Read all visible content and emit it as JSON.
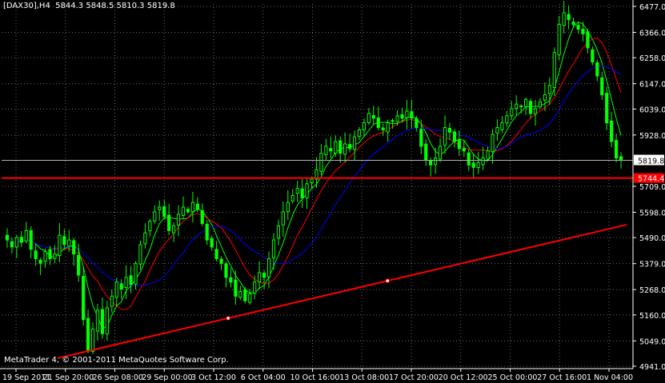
{
  "header": {
    "symbol_label": "[DAX30],H4",
    "open": "5844.3",
    "high": "5848.5",
    "low": "5810.3",
    "close": "5819.8"
  },
  "footer": {
    "copyright": "MetaTrader 4, © 2001-2011 MetaQuotes Software Corp."
  },
  "colors": {
    "background": "#000000",
    "grid": "#c0c0c0",
    "candle": "#00ff00",
    "ma_fast": "#00ff00",
    "ma_mid": "#ff0000",
    "ma_slow": "#0000ff",
    "trendline": "#ff0000",
    "hline": "#ff0000",
    "axis_text": "#ffffff"
  },
  "chart_data": {
    "type": "candlestick",
    "timeframe": "H4",
    "y_ticks": [
      "6477.0",
      "6366.0",
      "6258.0",
      "6147.0",
      "6039.0",
      "5928.0",
      "5819.8",
      "5709.0",
      "5598.0",
      "5490.0",
      "5379.0",
      "5268.0",
      "5160.0",
      "5049.0",
      "4941.0"
    ],
    "ylim": [
      4941.0,
      6477.0
    ],
    "x_ticks": [
      "19 Sep 2011",
      "21 Sep 20:00",
      "26 Sep 08:00",
      "29 Sep 00:00",
      "3 Oct 12:00",
      "6 Oct 04:00",
      "10 Oct 16:00",
      "13 Oct 08:00",
      "17 Oct 20:00",
      "20 Oct 12:00",
      "25 Oct 00:00",
      "27 Oct 16:00",
      "1 Nov 04:00"
    ],
    "current_price_label": "5819.8",
    "horizontal_line": {
      "value": "5744.4",
      "label": "5744.4"
    },
    "trendline": {
      "points": [
        {
          "x": "21 Sep 20:00",
          "y": 4975
        },
        {
          "x": "1 Nov 04:00",
          "y": 5545
        }
      ]
    },
    "close_path": [
      5480,
      5450,
      5490,
      5470,
      5520,
      5440,
      5400,
      5380,
      5430,
      5400,
      5420,
      5500,
      5460,
      5480,
      5420,
      5330,
      5140,
      5010,
      5100,
      5180,
      5080,
      5190,
      5240,
      5300,
      5270,
      5320,
      5290,
      5380,
      5460,
      5510,
      5560,
      5600,
      5620,
      5580,
      5520,
      5540,
      5590,
      5620,
      5600,
      5640,
      5610,
      5550,
      5480,
      5450,
      5400,
      5380,
      5320,
      5300,
      5240,
      5260,
      5220,
      5250,
      5300,
      5340,
      5320,
      5400,
      5480,
      5540,
      5600,
      5640,
      5670,
      5700,
      5660,
      5720,
      5740,
      5780,
      5850,
      5880,
      5860,
      5900,
      5850,
      5890,
      5870,
      5920,
      5950,
      5980,
      6020,
      6000,
      5960,
      5950,
      5980,
      5990,
      6010,
      6000,
      6030,
      6000,
      5960,
      5880,
      5820,
      5800,
      5830,
      5880,
      5960,
      5940,
      5900,
      5870,
      5860,
      5800,
      5790,
      5810,
      5830,
      5860,
      5930,
      5960,
      5980,
      6010,
      6040,
      6060,
      6050,
      6080,
      6020,
      6040,
      6070,
      6100,
      6140,
      6280,
      6400,
      6450,
      6420,
      6400,
      6380,
      6360,
      6300,
      6240,
      6180,
      6100,
      5980,
      5900,
      5830,
      5819.8
    ]
  }
}
